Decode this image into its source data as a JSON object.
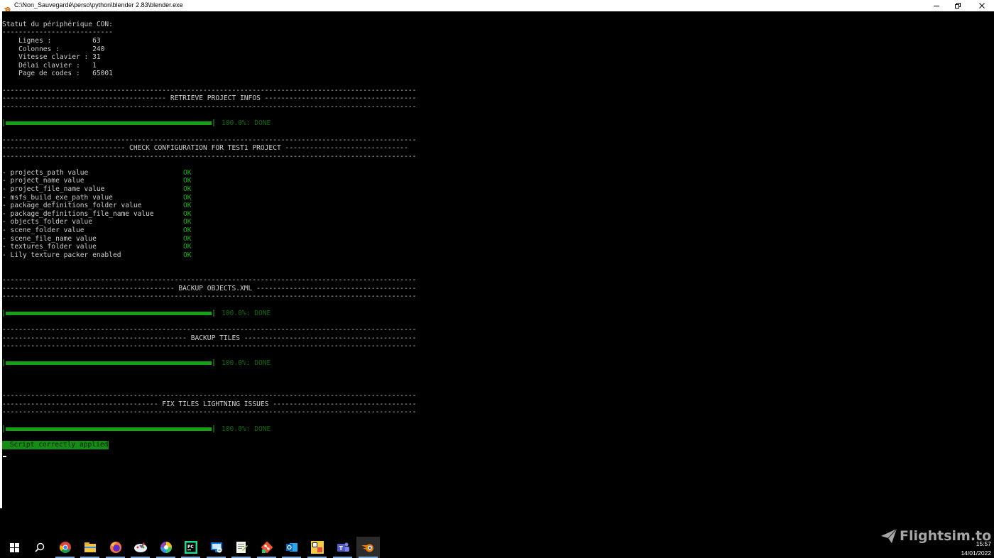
{
  "window": {
    "title": "C:\\Non_Sauvegardé\\perso\\python\\blender 2.83\\blender.exe",
    "icon": "blender-icon",
    "controls": [
      "minimize-icon",
      "restore-icon",
      "close-icon"
    ]
  },
  "console": {
    "status_header": "Statut du périphérique CON:",
    "status_underline": "---------------------------",
    "status_rows": [
      "    Lignes :          63",
      "    Colonnes :        240",
      "    Vitesse clavier : 31",
      "    Délai clavier :   1",
      "    Page de codes :   65001"
    ],
    "rule": "-----------------------------------------------------------------------------------------------------------------------------------",
    "sections": [
      {
        "title": "---------------------------------------- RETRIEVE PROJECT INFOS ----------------------------------------"
      },
      {
        "title": "------------------------------ CHECK CONFIGURATION FOR TEST1 PROJECT ------------------------------"
      },
      {
        "title": "------------------------------------------ BACKUP OBJECTS.XML ------------------------------------------"
      },
      {
        "title": "--------------------------------------------- BACKUP TILES ---------------------------------------------"
      },
      {
        "title": "-------------------------------------- FIX TILES LIGHTNING ISSUES --------------------------------------"
      }
    ],
    "progress": {
      "percent": 100,
      "label": "100.0%: DONE"
    },
    "checks": [
      {
        "label": "- projects_path value",
        "status": "OK"
      },
      {
        "label": "- project_name value",
        "status": "OK"
      },
      {
        "label": "- project_file_name value",
        "status": "OK"
      },
      {
        "label": "- msfs_build_exe_path value",
        "status": "OK"
      },
      {
        "label": "- package_definitions_folder value",
        "status": "OK"
      },
      {
        "label": "- package_definitions_file_name value",
        "status": "OK"
      },
      {
        "label": "- objects_folder value",
        "status": "OK"
      },
      {
        "label": "- scene_folder value",
        "status": "OK"
      },
      {
        "label": "- scene_file_name value",
        "status": "OK"
      },
      {
        "label": "- textures_folder value",
        "status": "OK"
      },
      {
        "label": "- Lily texture packer enabled",
        "status": "OK"
      }
    ],
    "final_message": " Script correctly applied",
    "colors": {
      "ok": "#13b313",
      "progress": "#16a016",
      "final_bg": "#138d13"
    }
  },
  "taskbar": {
    "items": [
      "windows-start-icon",
      "search-icon",
      "chrome-icon",
      "file-explorer-icon",
      "firefox-icon",
      "paint-icon",
      "color-picker-icon",
      "pycharm-icon",
      "remote-desktop-icon",
      "notepad-plus-plus-icon",
      "git-icon",
      "outlook-icon",
      "app-yellow-icon",
      "teams-icon",
      "blender-icon"
    ],
    "active_item": "blender-icon",
    "clock": {
      "time": "15:57",
      "date": "14/01/2022"
    }
  },
  "watermark": {
    "text": "Flightsim.to"
  }
}
